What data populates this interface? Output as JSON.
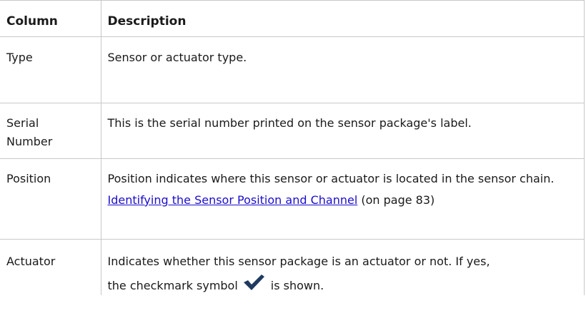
{
  "table": {
    "headers": [
      "Column",
      "Description"
    ],
    "rows": [
      {
        "column": "Type",
        "description": "Sensor or actuator type."
      },
      {
        "column": "Serial Number",
        "description": "This is the serial number printed on the sensor package's label."
      },
      {
        "column": "Position",
        "description": "Position indicates where this sensor or actuator is located in the sensor chain.",
        "link_text": "Identifying the Sensor Position and Channel",
        "link_suffix": " (on page 83)"
      },
      {
        "column": "Actuator",
        "description_line1": "Indicates whether this sensor package is an actuator or not. If yes,",
        "description_pre_icon": "the checkmark symbol",
        "icon": "checkmark-icon",
        "description_post_icon": "is shown."
      }
    ]
  },
  "colors": {
    "link": "#1a0dcc",
    "border": "#c8c8c8",
    "icon": "#1f3a5f"
  }
}
